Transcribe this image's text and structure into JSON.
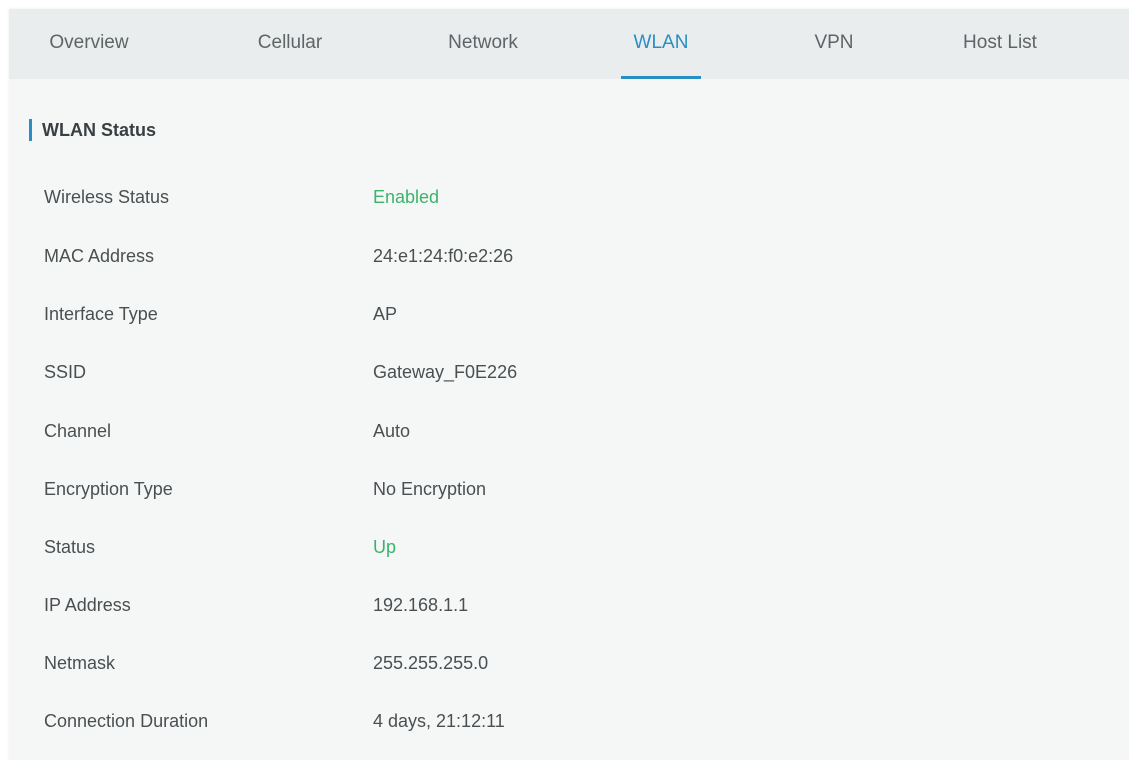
{
  "colors": {
    "accent": "#2a8dc4",
    "status_ok": "#3cb36a",
    "text": "#4a4f52",
    "tabbar_bg": "#eaeded",
    "panel_bg": "#f5f7f7"
  },
  "tabs": [
    {
      "label": "Overview",
      "active": false
    },
    {
      "label": "Cellular",
      "active": false
    },
    {
      "label": "Network",
      "active": false
    },
    {
      "label": "WLAN",
      "active": true
    },
    {
      "label": "VPN",
      "active": false
    },
    {
      "label": "Host List",
      "active": false
    }
  ],
  "section": {
    "title": "WLAN Status"
  },
  "fields": [
    {
      "label": "Wireless Status",
      "value": "Enabled"
    },
    {
      "label": "MAC Address",
      "value": "24:e1:24:f0:e2:26"
    },
    {
      "label": "Interface Type",
      "value": "AP"
    },
    {
      "label": "SSID",
      "value": "Gateway_F0E226"
    },
    {
      "label": "Channel",
      "value": "Auto"
    },
    {
      "label": "Encryption Type",
      "value": "No Encryption"
    },
    {
      "label": "Status",
      "value": "Up"
    },
    {
      "label": "IP Address",
      "value": "192.168.1.1"
    },
    {
      "label": "Netmask",
      "value": "255.255.255.0"
    },
    {
      "label": "Connection Duration",
      "value": "4 days, 21:12:11"
    }
  ]
}
